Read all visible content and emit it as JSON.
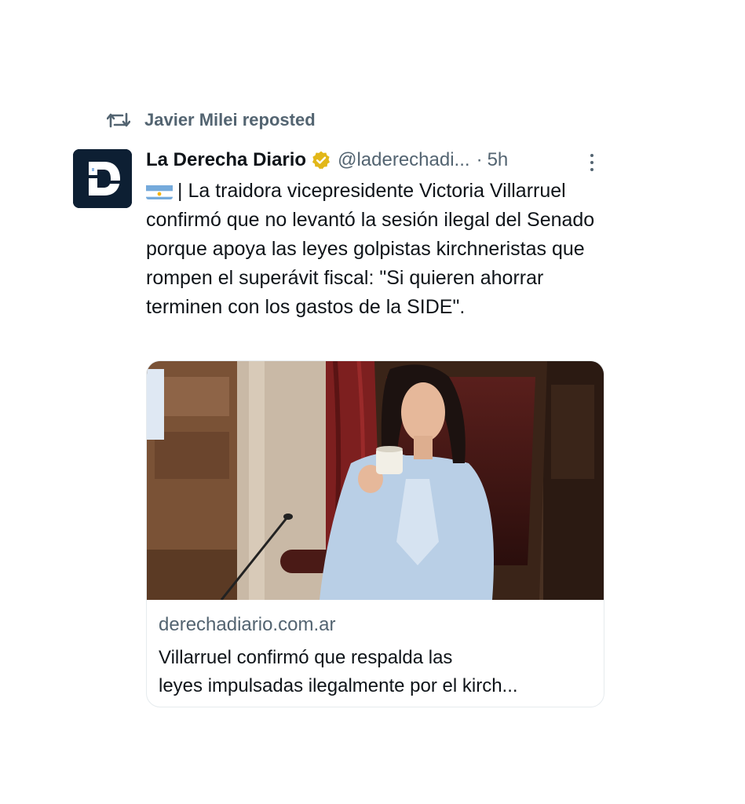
{
  "repost": {
    "icon": "repost-icon",
    "label": "Javier Milei reposted"
  },
  "tweet": {
    "avatar_letter": "D",
    "author_name": "La Derecha Diario",
    "verified_icon": "gold-verified-badge-icon",
    "handle": "@laderechadi...",
    "separator": "·",
    "time": "5h",
    "more_icon": "more-options-icon",
    "flag_icon": "argentina-flag-emoji",
    "text": "| La traidora vicepresidente Victoria Villarruel confirmó que no levantó la sesión ilegal del Senado porque apoya las leyes golpistas kirchneristas que rompen el superávit fiscal: \"Si quieren ahorrar terminen con los gastos de la SIDE\"."
  },
  "link_card": {
    "domain": "derechadiario.com.ar",
    "title_line1": "Villarruel confirmó que respalda las",
    "title_line2": "leyes impulsadas ilegalmente por el kirch..."
  },
  "colors": {
    "text_primary": "#0f1419",
    "text_secondary": "#536471",
    "verified_gold": "#e2b719",
    "avatar_bg": "#0d1f33",
    "card_border": "#e6ebee"
  }
}
